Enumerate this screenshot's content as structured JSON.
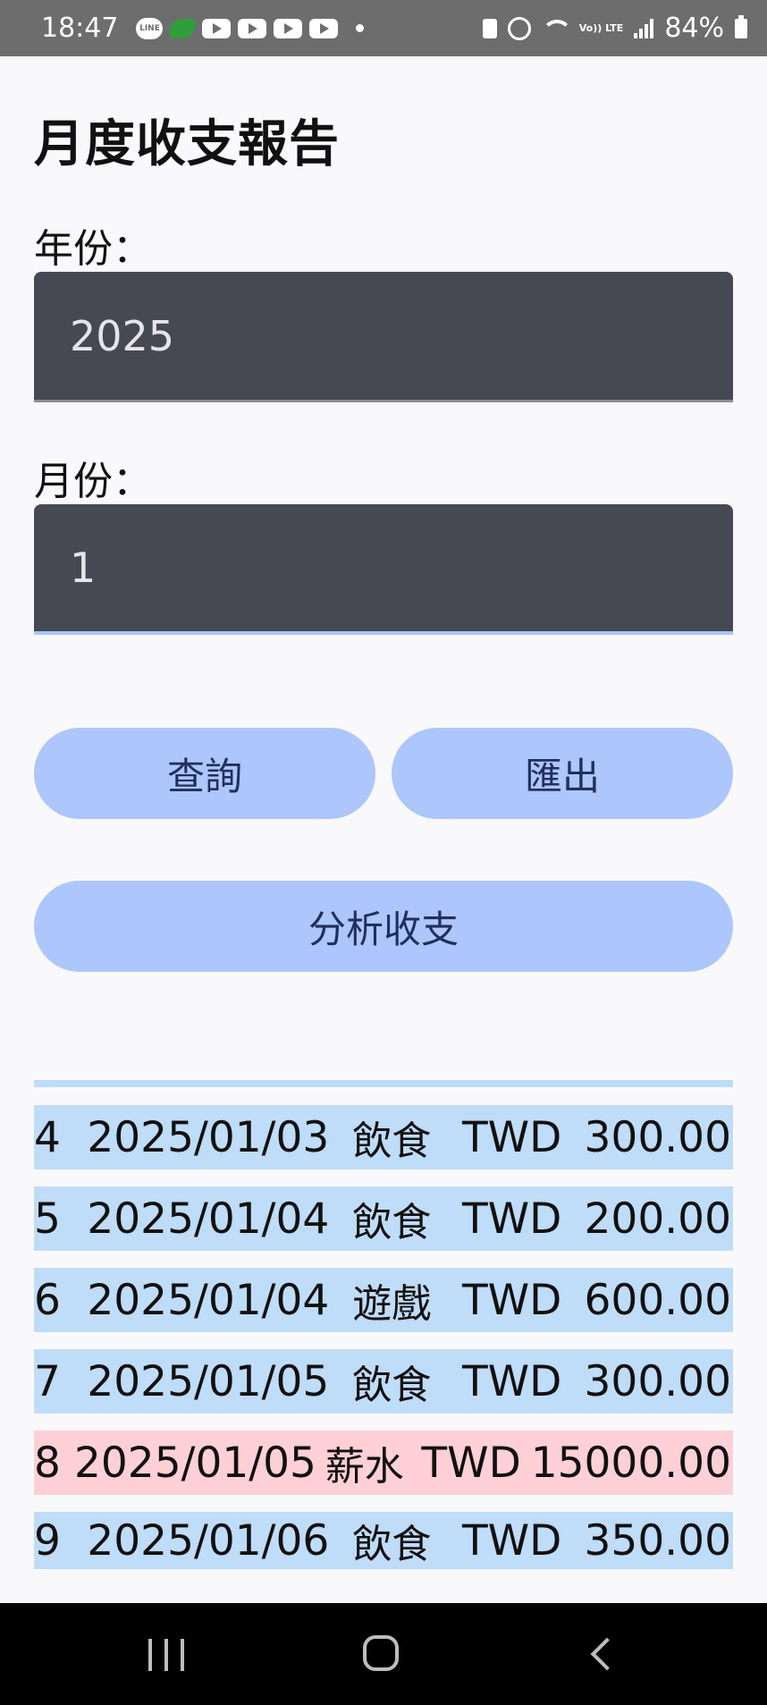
{
  "status_bar": {
    "time": "18:47",
    "notification_icons": [
      "line-icon",
      "leaf-app-icon",
      "youtube-icon",
      "youtube-icon",
      "youtube-icon",
      "youtube-icon"
    ],
    "line_icon_text": "LINE",
    "lte_text": "Vo)) LTE",
    "battery": "84%"
  },
  "page": {
    "title": "月度收支報告"
  },
  "form": {
    "year_label": "年份：",
    "year_value": "2025",
    "month_label": "月份：",
    "month_value": "1"
  },
  "buttons": {
    "query": "查詢",
    "export": "匯出",
    "analyze": "分析收支"
  },
  "colors": {
    "expense_row": "#bfdcf8",
    "income_row": "#ffd0d6",
    "button": "#adc6fb",
    "field": "#464852"
  },
  "records": [
    {
      "id": "4",
      "date": "2025/01/03",
      "category": "飲食",
      "currency": "TWD",
      "amount": "300.00",
      "type": "expense"
    },
    {
      "id": "5",
      "date": "2025/01/04",
      "category": "飲食",
      "currency": "TWD",
      "amount": "200.00",
      "type": "expense"
    },
    {
      "id": "6",
      "date": "2025/01/04",
      "category": "遊戲",
      "currency": "TWD",
      "amount": "600.00",
      "type": "expense"
    },
    {
      "id": "7",
      "date": "2025/01/05",
      "category": "飲食",
      "currency": "TWD",
      "amount": "300.00",
      "type": "expense"
    },
    {
      "id": "8",
      "date": "2025/01/05",
      "category": "薪水",
      "currency": "TWD",
      "amount": "15000.00",
      "type": "income"
    },
    {
      "id": "9",
      "date": "2025/01/06",
      "category": "飲食",
      "currency": "TWD",
      "amount": "350.00",
      "type": "expense"
    }
  ],
  "nav_bar": {
    "icons": [
      "recents-icon",
      "home-icon",
      "back-icon"
    ]
  }
}
